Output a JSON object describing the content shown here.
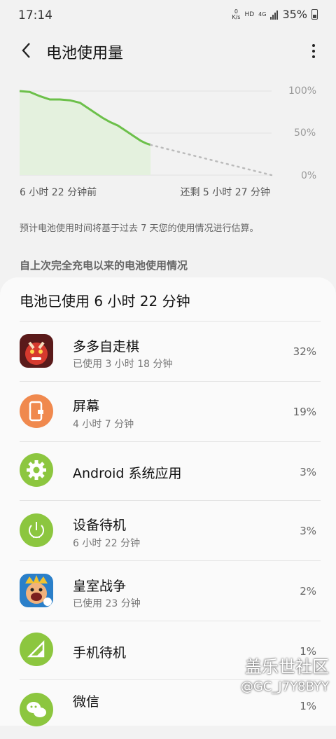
{
  "status_bar": {
    "time": "17:14",
    "speed_top": "0",
    "speed_unit": "K/s",
    "hd": "HD",
    "network": "4G",
    "battery_percent": "35%"
  },
  "header": {
    "title": "电池使用量"
  },
  "chart_data": {
    "type": "area",
    "y_ticks": [
      "100%",
      "50%",
      "0%"
    ],
    "x_start_label": "6 小时 22 分钟前",
    "x_end_label": "还剩 5 小时 27 分钟",
    "ylim": [
      0,
      100
    ],
    "usage_series": {
      "x": [
        0,
        0.04,
        0.08,
        0.12,
        0.16,
        0.2,
        0.24,
        0.27,
        0.3,
        0.33,
        0.36,
        0.39,
        0.42,
        0.45,
        0.48,
        0.5,
        0.52
      ],
      "y": [
        100,
        99,
        94,
        90,
        90,
        89,
        86,
        80,
        74,
        68,
        63,
        59,
        53,
        47,
        41,
        38,
        36
      ]
    },
    "projection_series": {
      "x": [
        0.52,
        1.0
      ],
      "y": [
        36,
        0
      ]
    }
  },
  "note": "预计电池使用时间将基于过去 7 天您的使用情况进行估算。",
  "section_title": "自上次完全充电以来的电池使用情况",
  "card": {
    "title": "电池已使用 6 小时 22 分钟",
    "items": [
      {
        "name": "多多自走棋",
        "sub": "已使用 3 小时 18 分钟",
        "percent": "32%",
        "icon": "auto-chess-icon"
      },
      {
        "name": "屏幕",
        "sub": "4 小时 7 分钟",
        "percent": "19%",
        "icon": "screen-icon"
      },
      {
        "name": "Android 系统应用",
        "sub": "",
        "percent": "3%",
        "icon": "gear-icon"
      },
      {
        "name": "设备待机",
        "sub": "6 小时 22 分钟",
        "percent": "3%",
        "icon": "power-icon"
      },
      {
        "name": "皇室战争",
        "sub": "已使用 23 分钟",
        "percent": "2%",
        "icon": "clash-royale-icon"
      },
      {
        "name": "手机待机",
        "sub": "",
        "percent": "1%",
        "icon": "signal-icon"
      },
      {
        "name": "微信",
        "sub": "",
        "percent": "1%",
        "icon": "wechat-icon"
      }
    ]
  },
  "watermark": {
    "line1": "盖乐世社区",
    "line2": "@GC_J7Y8BYY"
  },
  "colors": {
    "green": "#8cc63f",
    "orange": "#f0894e",
    "chart_line": "#6cc04a"
  }
}
